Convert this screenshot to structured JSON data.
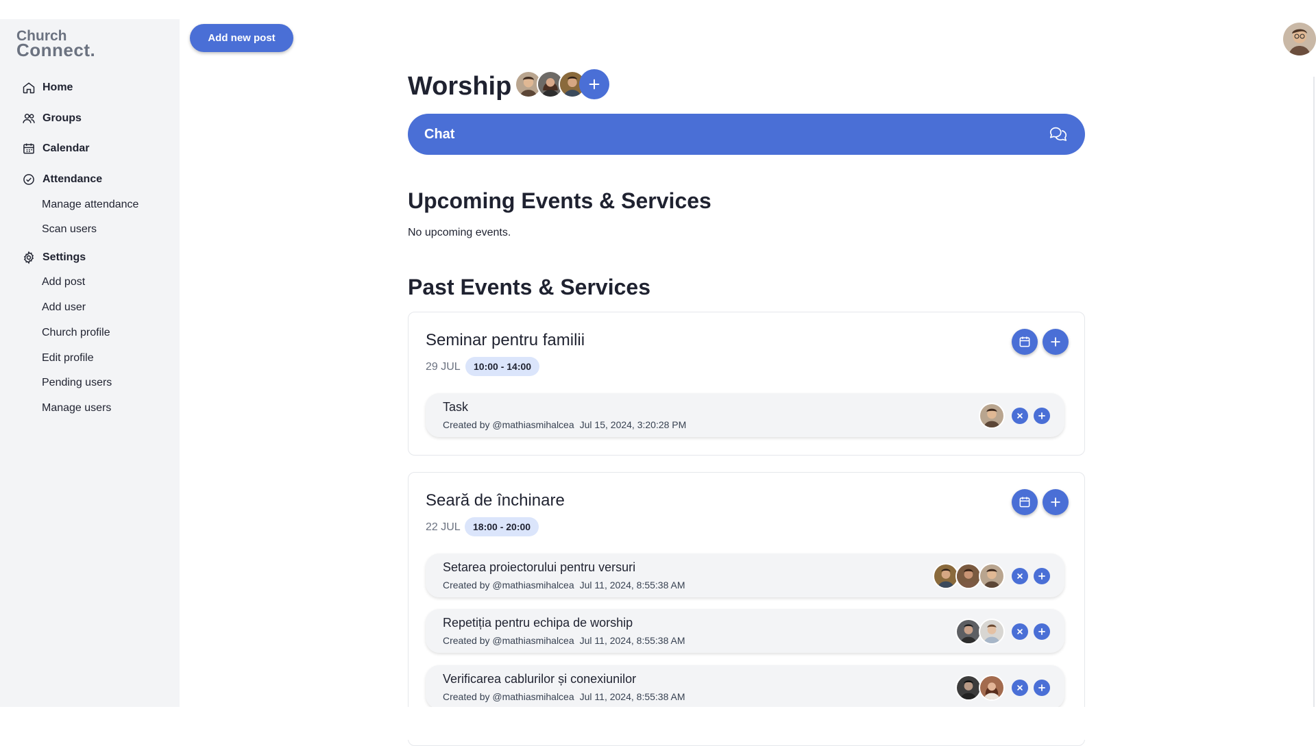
{
  "brand": {
    "line1": "Church",
    "line2": "Connect."
  },
  "sidebar": {
    "items": [
      {
        "label": "Home",
        "icon": "home-icon"
      },
      {
        "label": "Groups",
        "icon": "users-icon"
      },
      {
        "label": "Calendar",
        "icon": "calendar-icon"
      },
      {
        "label": "Attendance",
        "icon": "check-circle-icon"
      },
      {
        "label": "Manage attendance"
      },
      {
        "label": "Scan users"
      },
      {
        "label": "Settings",
        "icon": "gear-icon"
      },
      {
        "label": "Add post"
      },
      {
        "label": "Add user"
      },
      {
        "label": "Church profile"
      },
      {
        "label": "Edit profile"
      },
      {
        "label": "Pending users"
      },
      {
        "label": "Manage users"
      }
    ]
  },
  "header": {
    "add_post_label": "Add new post"
  },
  "group": {
    "title": "Worship"
  },
  "chat": {
    "label": "Chat"
  },
  "upcoming": {
    "heading": "Upcoming Events & Services",
    "empty_text": "No upcoming events."
  },
  "past": {
    "heading": "Past Events & Services",
    "events": [
      {
        "title": "Seminar pentru familii",
        "date": "29 JUL",
        "time": "10:00 - 14:00",
        "tasks": [
          {
            "title": "Task",
            "created_by": "Created by @mathiasmihalcea",
            "timestamp": "Jul 15, 2024, 3:20:28 PM"
          }
        ]
      },
      {
        "title": "Seară de închinare",
        "date": "22 JUL",
        "time": "18:00 - 20:00",
        "tasks": [
          {
            "title": "Setarea proiectorului pentru versuri",
            "created_by": "Created by @mathiasmihalcea",
            "timestamp": "Jul 11, 2024, 8:55:38 AM"
          },
          {
            "title": "Repetiția pentru echipa de worship",
            "created_by": "Created by @mathiasmihalcea",
            "timestamp": "Jul 11, 2024, 8:55:38 AM"
          },
          {
            "title": "Verificarea cablurilor și conexiunilor",
            "created_by": "Created by @mathiasmihalcea",
            "timestamp": "Jul 11, 2024, 8:55:38 AM"
          }
        ]
      }
    ]
  },
  "colors": {
    "accent": "#4a6fd6",
    "sidebar_bg": "#f3f4f6",
    "time_badge": "#dbe5fb"
  }
}
